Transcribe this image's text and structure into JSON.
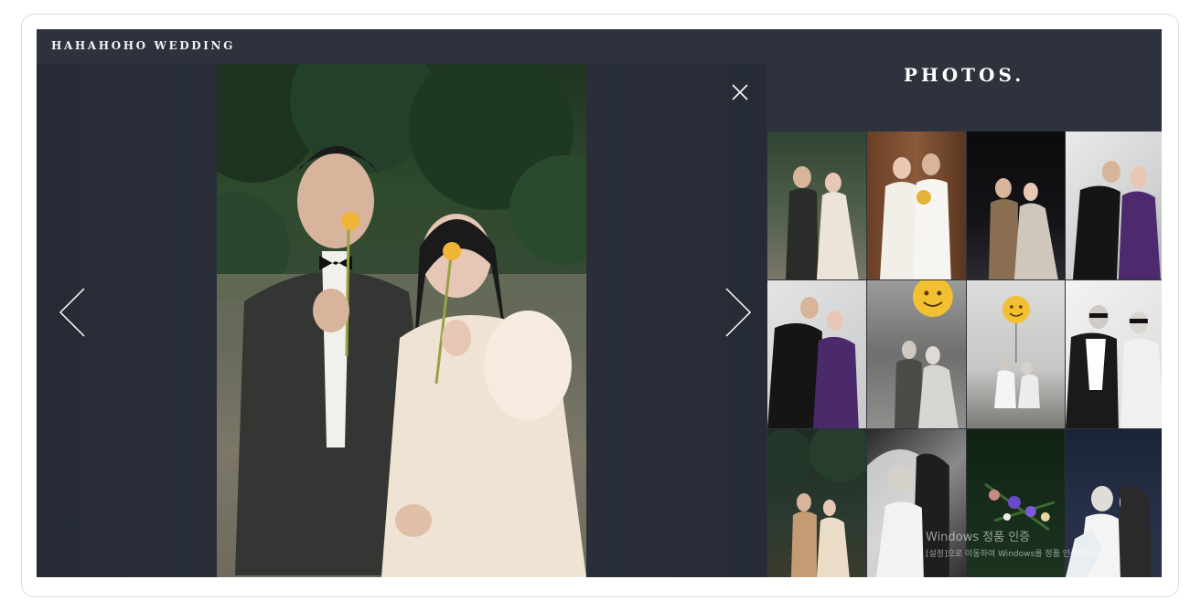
{
  "brand": {
    "name": "HAHAHOHO WEDDING"
  },
  "panel": {
    "title": "PHOTOS."
  },
  "viewer": {
    "prev_icon": "chevron-left-icon",
    "next_icon": "chevron-right-icon",
    "close_icon": "close-icon"
  },
  "thumbnails": [
    {
      "name": "photo-1"
    },
    {
      "name": "photo-2"
    },
    {
      "name": "photo-3"
    },
    {
      "name": "photo-4"
    },
    {
      "name": "photo-5"
    },
    {
      "name": "photo-6"
    },
    {
      "name": "photo-7"
    },
    {
      "name": "photo-8"
    },
    {
      "name": "photo-9"
    },
    {
      "name": "photo-10"
    },
    {
      "name": "photo-11"
    },
    {
      "name": "photo-12"
    }
  ],
  "watermark": {
    "title": "Windows 정품 인증",
    "subtitle": "[설정]으로 이동하여 Windows를 정품 인증합니다."
  },
  "colors": {
    "background": "#2d323d",
    "text": "#ffffff"
  }
}
